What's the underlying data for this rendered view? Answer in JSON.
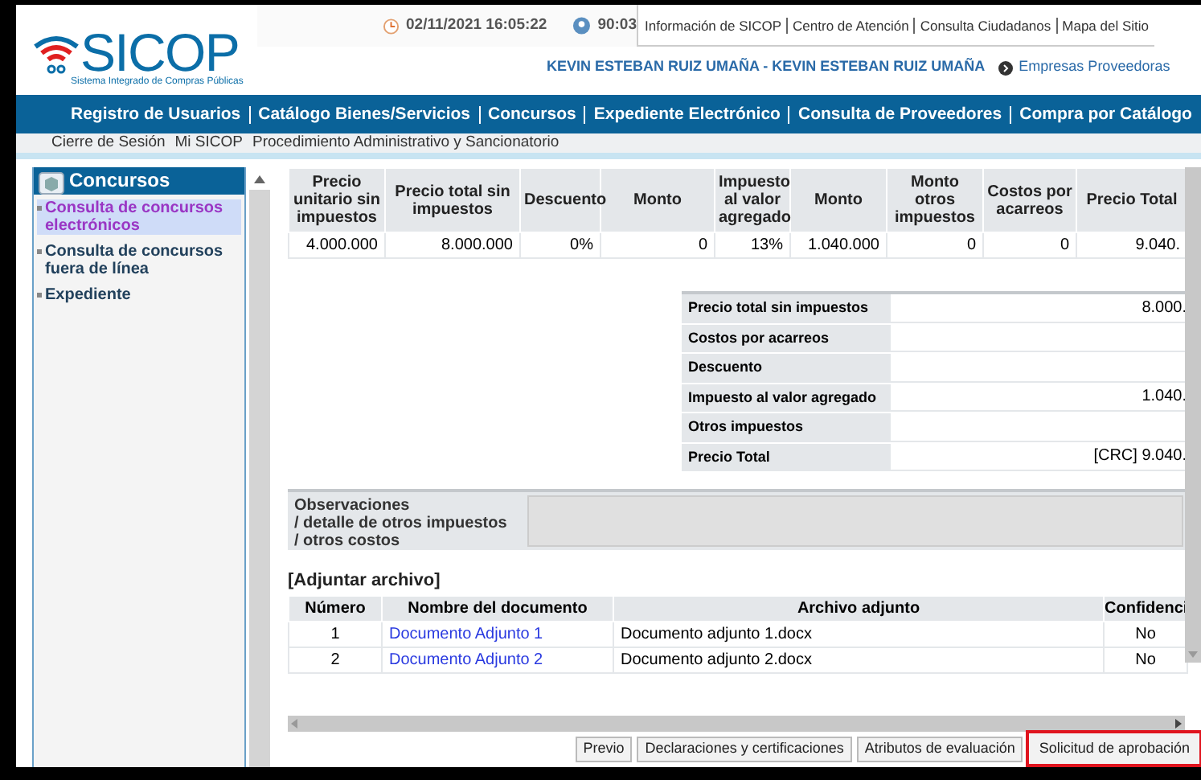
{
  "header": {
    "logo": "SICOP",
    "logo_subtitle": "Sistema Integrado de Compras Públicas",
    "datetime": "02/11/2021 16:05:22",
    "session_timer": "90:03",
    "top_links": [
      "Información de SICOP",
      "Centro de Atención",
      "Consulta Ciudadanos",
      "Mapa del Sitio"
    ],
    "user": "KEVIN ESTEBAN RUIZ UMAÑA - KEVIN ESTEBAN RUIZ UMAÑA",
    "company_link": "Empresas Proveedoras"
  },
  "nav": [
    "Registro de Usuarios",
    "Catálogo Bienes/Servicios",
    "Concursos",
    "Expediente Electrónico",
    "Consulta de Proveedores",
    "Compra por Catálogo"
  ],
  "subnav": [
    "Cierre de Sesión",
    "Mi SICOP",
    "Procedimiento Administrativo y Sancionatorio"
  ],
  "sidebar": {
    "title": "Concursos",
    "items": [
      {
        "label": "Consulta de concursos electrónicos",
        "selected": true
      },
      {
        "label": "Consulta de concursos fuera de línea",
        "selected": false
      },
      {
        "label": "Expediente",
        "selected": false
      }
    ]
  },
  "price_table": {
    "columns": [
      "Precio unitario sin impuestos",
      "Precio total sin impuestos",
      "Descuento",
      "Monto",
      "Impuesto al valor agregado",
      "Monto",
      "Monto otros impuestos",
      "Costos por acarreos",
      "Precio Total"
    ],
    "rows": [
      [
        "4.000.000",
        "8.000.000",
        "0%",
        "0",
        "13%",
        "1.040.000",
        "0",
        "0",
        "9.040."
      ]
    ]
  },
  "summary": [
    {
      "label": "Precio total sin impuestos",
      "value": "8.000."
    },
    {
      "label": "Costos por acarreos"
    },
    {
      "label": "Descuento"
    },
    {
      "label": "Impuesto al valor agregado",
      "value": "1.040."
    },
    {
      "label": "Otros impuestos"
    },
    {
      "label": "Precio Total",
      "value": "[CRC] 9.040."
    }
  ],
  "observations": {
    "label_lines": [
      "Observaciones",
      "/ detalle de otros impuestos",
      "/ otros costos"
    ]
  },
  "attachments": {
    "title": "[Adjuntar archivo]",
    "columns": [
      "Número",
      "Nombre del documento",
      "Archivo adjunto",
      "Confidenci"
    ],
    "rows": [
      {
        "number": "1",
        "name": "Documento Adjunto 1",
        "file": "Documento adjunto 1.docx",
        "confidential": "No"
      },
      {
        "number": "2",
        "name": "Documento Adjunto 2",
        "file": "Documento adjunto 2.docx",
        "confidential": "No"
      }
    ]
  },
  "buttons": [
    {
      "label": "Previo",
      "highlighted": false
    },
    {
      "label": "Declaraciones y certificaciones",
      "highlighted": false
    },
    {
      "label": "Atributos de evaluación",
      "highlighted": false
    },
    {
      "label": "Solicitud de aprobación",
      "highlighted": true
    }
  ]
}
